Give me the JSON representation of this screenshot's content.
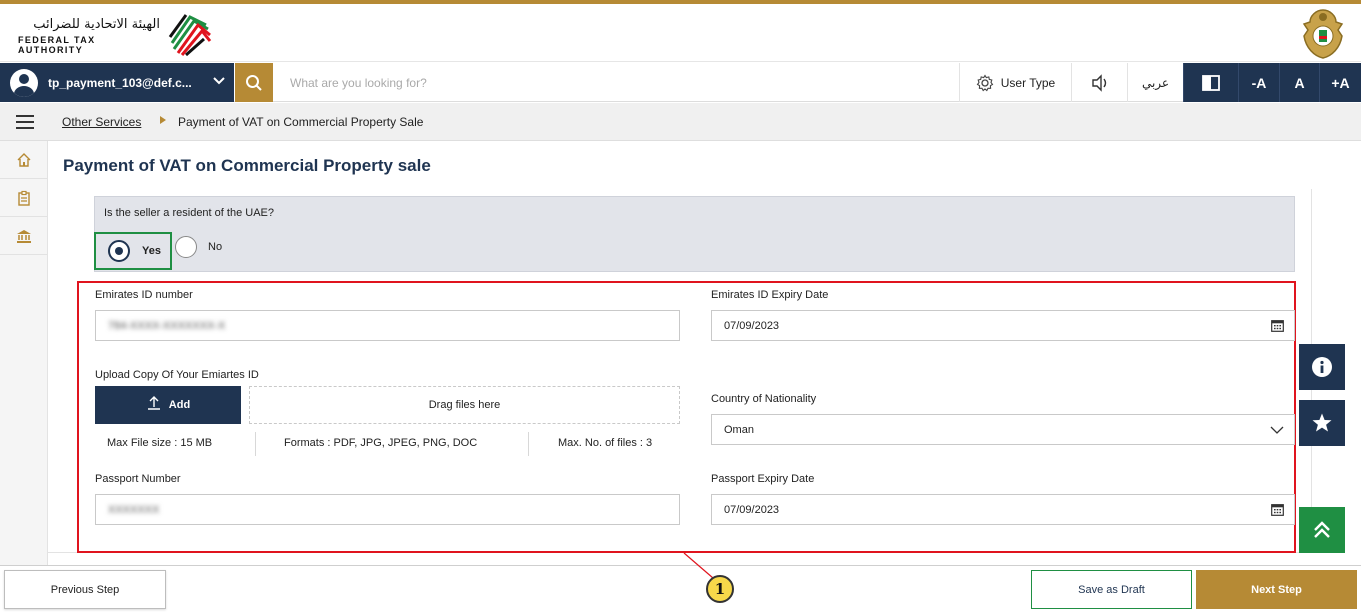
{
  "brand": {
    "name_ar": "الهيئة الاتحادية للضرائب",
    "name_en": "FEDERAL TAX AUTHORITY"
  },
  "user": {
    "email": "tp_payment_103@def.c..."
  },
  "search": {
    "placeholder": "What are you looking for?"
  },
  "nav": {
    "user_type_label": "User Type",
    "language_label": "عربي",
    "font_decrease_label": "-A",
    "font_reset_label": "A",
    "font_increase_label": "+A"
  },
  "breadcrumb": {
    "link": "Other Services",
    "current": "Payment of VAT on Commercial Property Sale"
  },
  "sidebar": {
    "items": [
      "home-icon",
      "clipboard-icon",
      "bank-icon"
    ]
  },
  "page": {
    "title": "Payment of VAT on Commercial Property sale"
  },
  "resident": {
    "question": "Is the seller a resident of the UAE?",
    "yes_label": "Yes",
    "no_label": "No",
    "selected": "Yes"
  },
  "form": {
    "emirates_id": {
      "label": "Emirates ID number",
      "value": "784-XXXX-XXXXXXX-X"
    },
    "emirates_id_expiry": {
      "label": "Emirates ID Expiry Date",
      "value": "07/09/2023"
    },
    "upload": {
      "label": "Upload Copy Of Your Emiartes ID",
      "add_label": "Add",
      "drop_label": "Drag files here",
      "max_size": "Max File size : 15 MB",
      "formats": "Formats : PDF, JPG, JPEG, PNG, DOC",
      "max_files": "Max. No. of files : 3"
    },
    "nationality": {
      "label": "Country of Nationality",
      "value": "Oman"
    },
    "passport_number": {
      "label": "Passport Number",
      "value": "XXXXXXX"
    },
    "passport_expiry": {
      "label": "Passport Expiry Date",
      "value": "07/09/2023"
    }
  },
  "footer": {
    "previous_label": "Previous Step",
    "draft_label": "Save as Draft",
    "next_label": "Next Step"
  },
  "annotation": {
    "callout_number": "1"
  },
  "colors": {
    "navy": "#1f3451",
    "gold": "#b68a35",
    "highlight_red": "#e0141e",
    "selected_green": "#1f8f43",
    "question_bg": "#e2e4ea"
  }
}
